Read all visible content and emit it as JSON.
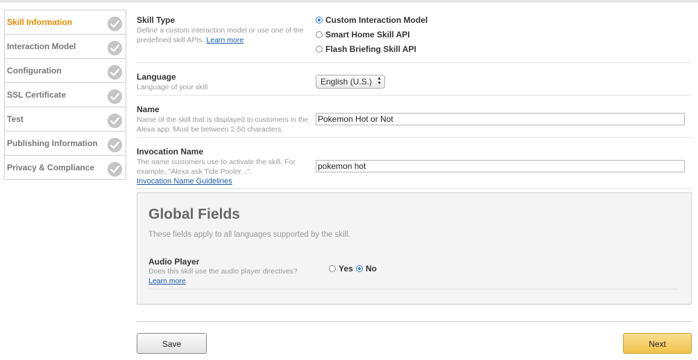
{
  "sidebar": {
    "items": [
      {
        "label": "Skill Information"
      },
      {
        "label": "Interaction Model"
      },
      {
        "label": "Configuration"
      },
      {
        "label": "SSL Certificate"
      },
      {
        "label": "Test"
      },
      {
        "label": "Publishing Information"
      },
      {
        "label": "Privacy & Compliance"
      }
    ]
  },
  "skill_type": {
    "title": "Skill Type",
    "desc": "Define a custom interaction model or use one of the predefined skill APIs.",
    "learn_more": "Learn more",
    "options": [
      "Custom Interaction Model",
      "Smart Home Skill API",
      "Flash Briefing Skill API"
    ],
    "selected": "Custom Interaction Model"
  },
  "language": {
    "title": "Language",
    "desc": "Language of your skill",
    "value": "English (U.S.)"
  },
  "name": {
    "title": "Name",
    "desc": "Name of the skill that is displayed to customers in the Alexa app. Must be between 2-50 characters.",
    "value": "Pokemon Hot or Not"
  },
  "invocation": {
    "title": "Invocation Name",
    "desc": "The name customers use to activate the skill. For example, \"Alexa ask Tide Pooler...\".",
    "guidelines": "Invocation Name Guidelines",
    "value": "pokemon hot"
  },
  "global": {
    "title": "Global Fields",
    "subtitle": "These fields apply to all languages supported by the skill.",
    "audio_player": {
      "title": "Audio Player",
      "desc": "Does this skill use the audio player directives?",
      "learn_more": "Learn more",
      "yes": "Yes",
      "no": "No",
      "selected": "No"
    }
  },
  "buttons": {
    "save": "Save",
    "next": "Next"
  },
  "colors": {
    "active_nav": "#e68a00",
    "link": "#1a5aa8",
    "radio_selected": "#2a7bd6",
    "next_button": "#f0c14b"
  }
}
